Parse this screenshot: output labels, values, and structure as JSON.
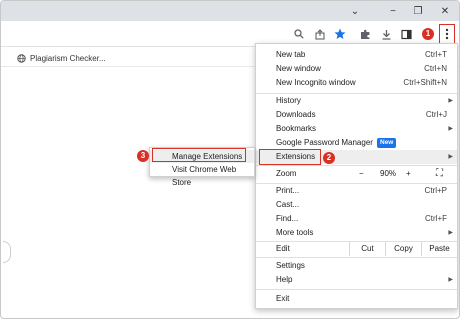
{
  "window": {
    "minimize": "−",
    "restore": "❐",
    "close": "✕",
    "tab_dropdown": "⌄"
  },
  "toolbar": {
    "icons": [
      "search-icon",
      "share-icon",
      "bookmark-star-icon",
      "extensions-puzzle-icon",
      "download-icon",
      "side-panel-icon",
      "kebab-menu-icon"
    ],
    "star_color": "#1a73e8"
  },
  "bookmarks": {
    "item_label": "Plagiarism Checker..."
  },
  "menu": {
    "new_tab": {
      "label": "New tab",
      "shortcut": "Ctrl+T"
    },
    "new_window": {
      "label": "New window",
      "shortcut": "Ctrl+N"
    },
    "new_incognito": {
      "label": "New Incognito window",
      "shortcut": "Ctrl+Shift+N"
    },
    "history": {
      "label": "History"
    },
    "downloads": {
      "label": "Downloads",
      "shortcut": "Ctrl+J"
    },
    "bookmarks": {
      "label": "Bookmarks"
    },
    "password_manager": {
      "label": "Google Password Manager",
      "badge": "New"
    },
    "extensions": {
      "label": "Extensions"
    },
    "zoom": {
      "label": "Zoom",
      "minus": "−",
      "value": "90%",
      "plus": "+",
      "fullscreen": "⛶"
    },
    "print": {
      "label": "Print...",
      "shortcut": "Ctrl+P"
    },
    "cast": {
      "label": "Cast..."
    },
    "find": {
      "label": "Find...",
      "shortcut": "Ctrl+F"
    },
    "more_tools": {
      "label": "More tools"
    },
    "edit": {
      "label": "Edit",
      "cut": "Cut",
      "copy": "Copy",
      "paste": "Paste"
    },
    "settings": {
      "label": "Settings"
    },
    "help": {
      "label": "Help"
    },
    "exit": {
      "label": "Exit"
    }
  },
  "submenu": {
    "manage_extensions": "Manage Extensions",
    "visit_store": "Visit Chrome Web Store"
  },
  "steps": [
    "1",
    "2",
    "3"
  ],
  "colors": {
    "highlight": "#d93025",
    "badge": "#1a73e8"
  }
}
